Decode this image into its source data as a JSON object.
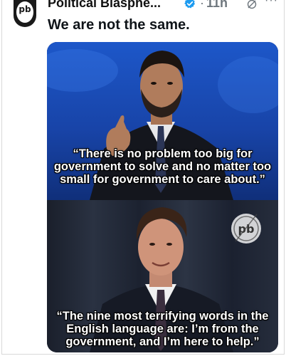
{
  "post": {
    "author_name": "Political Blasphe...",
    "timestamp": "11h",
    "separator": "·",
    "more_label": "···",
    "text": "We are not the same.",
    "avatar_text": "pb"
  },
  "media": {
    "quote_top": "“There is no problem too big for government to solve and no matter too small for government to care about.”",
    "quote_bottom": "“The nine most terrifying words in the English language are: I’m from the government, and I’m here to help.”",
    "watermark_text": "pb"
  },
  "colors": {
    "accent_verified": "#1d9bf0",
    "text_primary": "#0f1419",
    "text_secondary": "#6e767d"
  },
  "icons": [
    "verified-badge-icon",
    "grok-icon",
    "more-options-icon"
  ]
}
